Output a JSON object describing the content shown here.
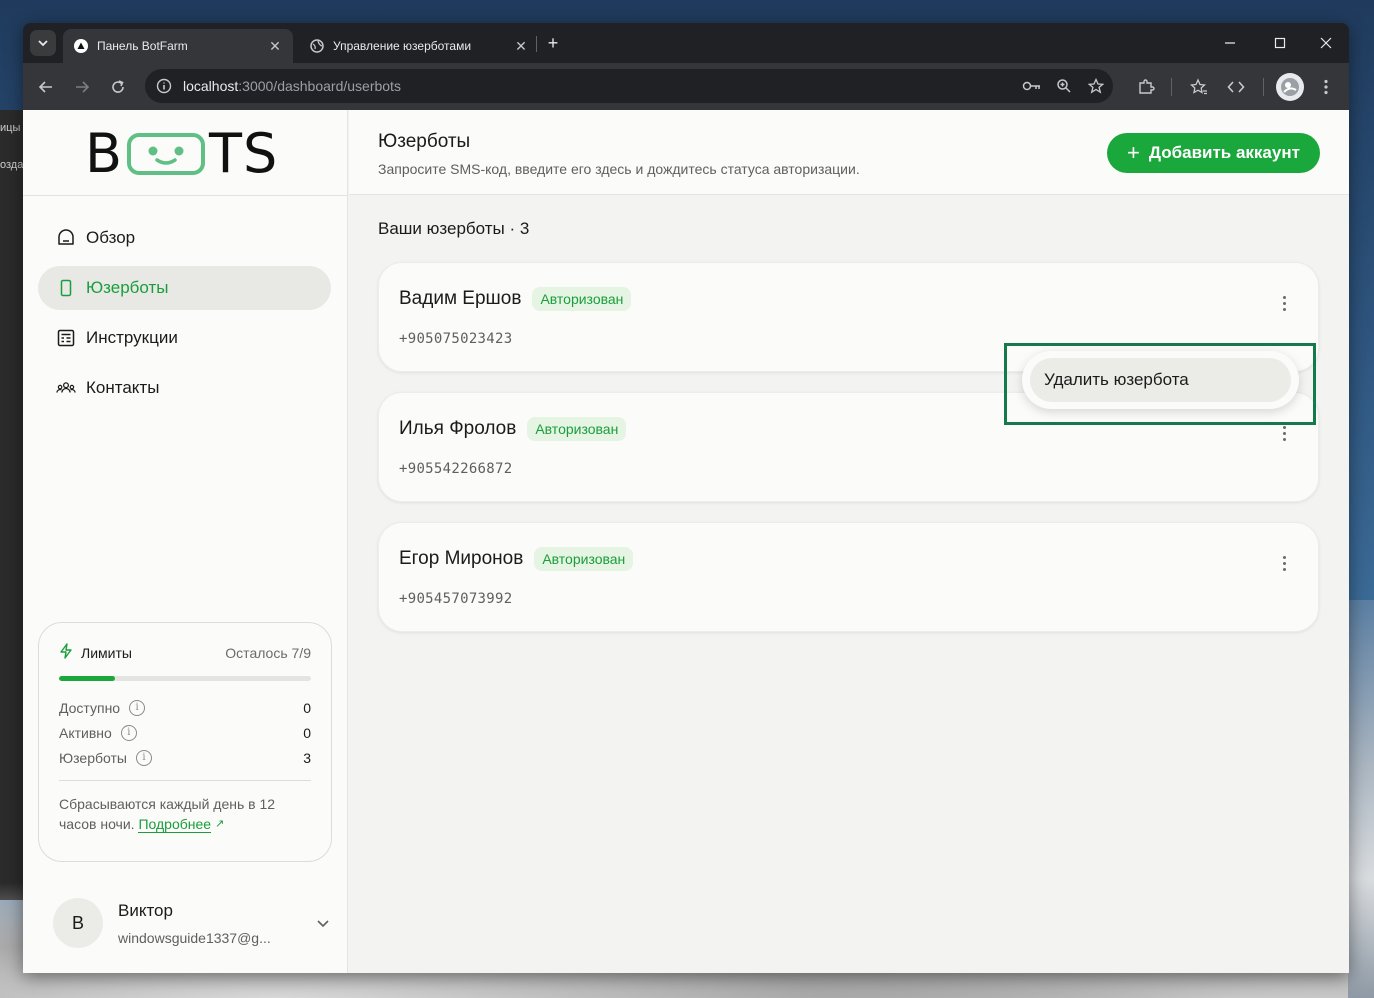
{
  "browser": {
    "tabs": [
      {
        "title": "Панель BotFarm",
        "active": true
      },
      {
        "title": "Управление юзерботами",
        "active": false
      }
    ],
    "url_host": "localhost",
    "url_path": ":3000/dashboard/userbots"
  },
  "background": {
    "left_fragment_1": "ицы",
    "left_fragment_2": "озда"
  },
  "sidebar": {
    "logo_left": "B",
    "logo_right": "TS",
    "nav": [
      {
        "label": "Обзор",
        "icon": "overview-icon",
        "active": false
      },
      {
        "label": "Юзерботы",
        "icon": "phone-icon",
        "active": true
      },
      {
        "label": "Инструкции",
        "icon": "document-icon",
        "active": false
      },
      {
        "label": "Контакты",
        "icon": "people-icon",
        "active": false
      }
    ],
    "limits": {
      "title": "Лимиты",
      "remaining": "Осталось 7/9",
      "progress_fraction": 0.222,
      "rows": [
        {
          "label": "Доступно",
          "value": "0"
        },
        {
          "label": "Активно",
          "value": "0"
        },
        {
          "label": "Юзерботы",
          "value": "3"
        }
      ],
      "note": "Сбрасываются каждый день в 12 часов ночи.",
      "more_link": "Подробнее",
      "more_arrow": "↗"
    },
    "user": {
      "initial": "В",
      "name": "Виктор",
      "email": "windowsguide1337@g..."
    }
  },
  "main": {
    "title": "Юзерботы",
    "subtitle": "Запросите SMS-код, введите его здесь и дождитесь статуса авторизации.",
    "add_button": "Добавить аккаунт",
    "list_title": "Ваши юзерботы · 3",
    "userbots": [
      {
        "name": "Вадим Ершов",
        "status": "Авторизован",
        "phone": "+905075023423"
      },
      {
        "name": "Илья Фролов",
        "status": "Авторизован",
        "phone": "+905542266872"
      },
      {
        "name": "Егор Миронов",
        "status": "Авторизован",
        "phone": "+905457073992"
      }
    ],
    "dropdown": {
      "item": "Удалить юзербота"
    }
  },
  "colors": {
    "accent": "#1aa83c",
    "badge_bg": "#e6f4e4",
    "highlight_outline": "#147a4c",
    "logo_face": "#5fbf84"
  }
}
